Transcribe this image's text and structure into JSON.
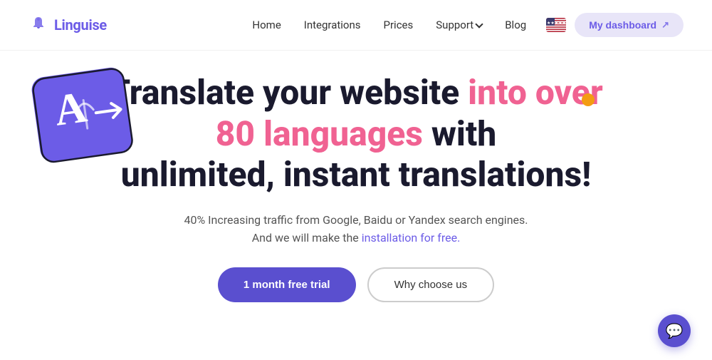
{
  "navbar": {
    "logo_text": "Linguise",
    "links": [
      {
        "label": "Home",
        "id": "home"
      },
      {
        "label": "Integrations",
        "id": "integrations"
      },
      {
        "label": "Prices",
        "id": "prices"
      },
      {
        "label": "Support",
        "id": "support",
        "has_dropdown": true
      },
      {
        "label": "Blog",
        "id": "blog"
      }
    ],
    "dashboard_label": "My dashboard"
  },
  "hero": {
    "heading_line1": "Translate your website ",
    "heading_highlight": "into over 80 languages",
    "heading_line3": " with unlimited, instant translations!",
    "subtext_line1": "40% Increasing traffic from Google, Baidu or Yandex search engines.",
    "subtext_line2": "And we will make the ",
    "subtext_link": "installation for free.",
    "cta_primary": "1 month free trial",
    "cta_secondary": "Why choose us"
  }
}
